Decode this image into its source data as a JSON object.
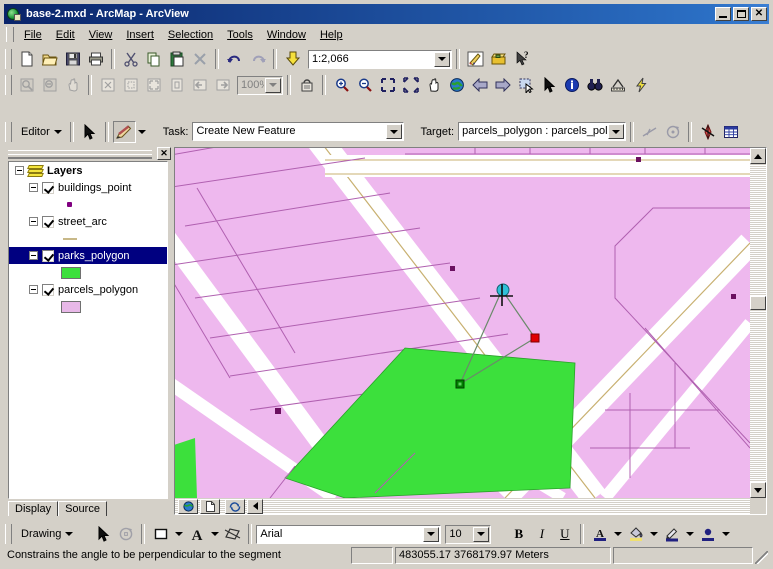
{
  "window": {
    "title": "base-2.mxd - ArcMap - ArcView",
    "icon": "arcmap-globe-icon",
    "minimize_label": "_",
    "maximize_label": "❐",
    "close_label": "✕"
  },
  "menu": {
    "items": [
      {
        "label": "File",
        "name": "menu-file"
      },
      {
        "label": "Edit",
        "name": "menu-edit"
      },
      {
        "label": "View",
        "name": "menu-view"
      },
      {
        "label": "Insert",
        "name": "menu-insert"
      },
      {
        "label": "Selection",
        "name": "menu-selection"
      },
      {
        "label": "Tools",
        "name": "menu-tools"
      },
      {
        "label": "Window",
        "name": "menu-window"
      },
      {
        "label": "Help",
        "name": "menu-help"
      }
    ]
  },
  "standard_toolbar": {
    "buttons": [
      {
        "name": "new-document-icon",
        "title": "New"
      },
      {
        "name": "open-folder-icon",
        "title": "Open"
      },
      {
        "name": "save-icon",
        "title": "Save"
      },
      {
        "name": "print-icon",
        "title": "Print"
      },
      {
        "name": "cut-scissors-icon",
        "title": "Cut"
      },
      {
        "name": "copy-icon",
        "title": "Copy"
      },
      {
        "name": "paste-clipboard-icon",
        "title": "Paste"
      },
      {
        "name": "delete-x-icon",
        "title": "Delete"
      },
      {
        "name": "undo-arrow-icon",
        "title": "Undo"
      },
      {
        "name": "redo-arrow-icon",
        "title": "Redo"
      },
      {
        "name": "add-data-icon",
        "title": "Add Data"
      }
    ],
    "scale": {
      "value": "1:2,066",
      "name": "map-scale-combo"
    },
    "right_buttons": [
      {
        "name": "editor-toolbar-toggle-icon",
        "title": "Editor Toolbar"
      },
      {
        "name": "arctoolbox-icon",
        "title": "ArcToolbox"
      },
      {
        "name": "whats-this-help-icon",
        "title": "What's This?"
      }
    ]
  },
  "tools_toolbar": {
    "disabled_buttons": [
      {
        "name": "layout-zoom-in-icon"
      },
      {
        "name": "layout-zoom-out-icon"
      },
      {
        "name": "layout-pan-icon"
      },
      {
        "name": "zoom-whole-page-icon"
      },
      {
        "name": "zoom-100-page-icon"
      },
      {
        "name": "fixed-zoom-in-page-icon"
      },
      {
        "name": "fixed-zoom-out-page-icon"
      },
      {
        "name": "go-back-extent-icon"
      },
      {
        "name": "go-forward-extent-icon"
      }
    ],
    "zoom_percent": {
      "value": "100%",
      "name": "page-zoom-combo"
    },
    "toggle_draw_icon": {
      "name": "toggle-draft-mode-icon"
    },
    "buttons": [
      {
        "name": "zoom-in-icon",
        "title": "Zoom In"
      },
      {
        "name": "zoom-out-icon",
        "title": "Zoom Out"
      },
      {
        "name": "fixed-zoom-in-icon",
        "title": "Fixed Zoom In"
      },
      {
        "name": "fixed-zoom-out-icon",
        "title": "Fixed Zoom Out"
      },
      {
        "name": "pan-hand-icon",
        "title": "Pan"
      },
      {
        "name": "full-extent-globe-icon",
        "title": "Full Extent"
      },
      {
        "name": "back-extent-icon",
        "title": "Go Back To Previous Extent"
      },
      {
        "name": "forward-extent-icon",
        "title": "Go To Next Extent"
      },
      {
        "name": "select-features-icon",
        "title": "Select Features"
      },
      {
        "name": "select-elements-arrow-icon",
        "title": "Select Elements"
      },
      {
        "name": "identify-info-icon",
        "title": "Identify"
      },
      {
        "name": "find-binoculars-icon",
        "title": "Find"
      },
      {
        "name": "measure-icon",
        "title": "Measure"
      },
      {
        "name": "hyperlink-lightning-icon",
        "title": "Hyperlink"
      }
    ]
  },
  "editor_toolbar": {
    "menu_label": "Editor",
    "edit-tool-icon": "edit-arrow-icon",
    "sketch-tool-icon": "sketch-pencil-icon",
    "task_label": "Task:",
    "task_value": "Create New Feature",
    "target_label": "Target:",
    "target_value": "parcels_polygon : parcels_poly",
    "right_buttons": [
      {
        "name": "split-tool-icon"
      },
      {
        "name": "rotate-tool-icon"
      },
      {
        "name": "sketch-properties-icon"
      },
      {
        "name": "attributes-table-icon"
      }
    ]
  },
  "toc": {
    "panel_name": "table-of-contents",
    "close_label": "✕",
    "root_label": "Layers",
    "layers": [
      {
        "label": "buildings_point",
        "name": "layer-buildings-point",
        "symbol": "point",
        "color": "#800080",
        "checked": true,
        "selected": false
      },
      {
        "label": "street_arc",
        "name": "layer-street-arc",
        "symbol": "line",
        "color": "#c8b888",
        "checked": true,
        "selected": false
      },
      {
        "label": "parks_polygon",
        "name": "layer-parks-polygon",
        "symbol": "polygon",
        "color": "#38e038",
        "checked": true,
        "selected": true
      },
      {
        "label": "parcels_polygon",
        "name": "layer-parcels-polygon",
        "symbol": "polygon",
        "color": "#e8b8e8",
        "checked": true,
        "selected": false
      }
    ],
    "tabs": [
      {
        "label": "Display",
        "name": "toc-tab-display",
        "active": true
      },
      {
        "label": "Source",
        "name": "toc-tab-source",
        "active": false
      }
    ]
  },
  "map": {
    "name": "map-canvas",
    "parcel_fill": "#eeb8ee",
    "parcel_outline": "#b060b0",
    "park_fill": "#3ce03c",
    "street_fill": "#ffffff",
    "street_casing": "#c8b070",
    "building_point_color": "#6b1060",
    "sketch": {
      "start_vertex_color": "#008000",
      "last_vertex_color": "#e00000",
      "current_vertex_color": "#30c0d8",
      "segment_color": "#6a8a6a"
    },
    "nav_buttons": [
      {
        "name": "map-view-globe-icon"
      },
      {
        "name": "layout-view-page-icon"
      },
      {
        "name": "refresh-view-icon"
      },
      {
        "name": "pause-drawing-icon"
      }
    ]
  },
  "drawing_toolbar": {
    "menu_label": "Drawing",
    "buttons": [
      {
        "name": "select-elements-arrow-icon"
      },
      {
        "name": "rotate-element-icon"
      },
      {
        "name": "new-rectangle-icon"
      },
      {
        "name": "new-text-icon"
      },
      {
        "name": "clip-to-shape-icon"
      }
    ],
    "font": {
      "value": "Arial",
      "name": "font-family-combo"
    },
    "font_size": {
      "value": "10",
      "name": "font-size-combo"
    },
    "bold_label": "B",
    "italic_label": "I",
    "underline_label": "U",
    "color_buttons": [
      {
        "name": "font-color-icon"
      },
      {
        "name": "fill-color-icon"
      },
      {
        "name": "line-color-icon"
      },
      {
        "name": "marker-color-icon"
      }
    ]
  },
  "status_bar": {
    "message": "Constrains the angle to be perpendicular to the segment",
    "coordinates": "483055.17  3768179.97 Meters",
    "extra": ""
  }
}
